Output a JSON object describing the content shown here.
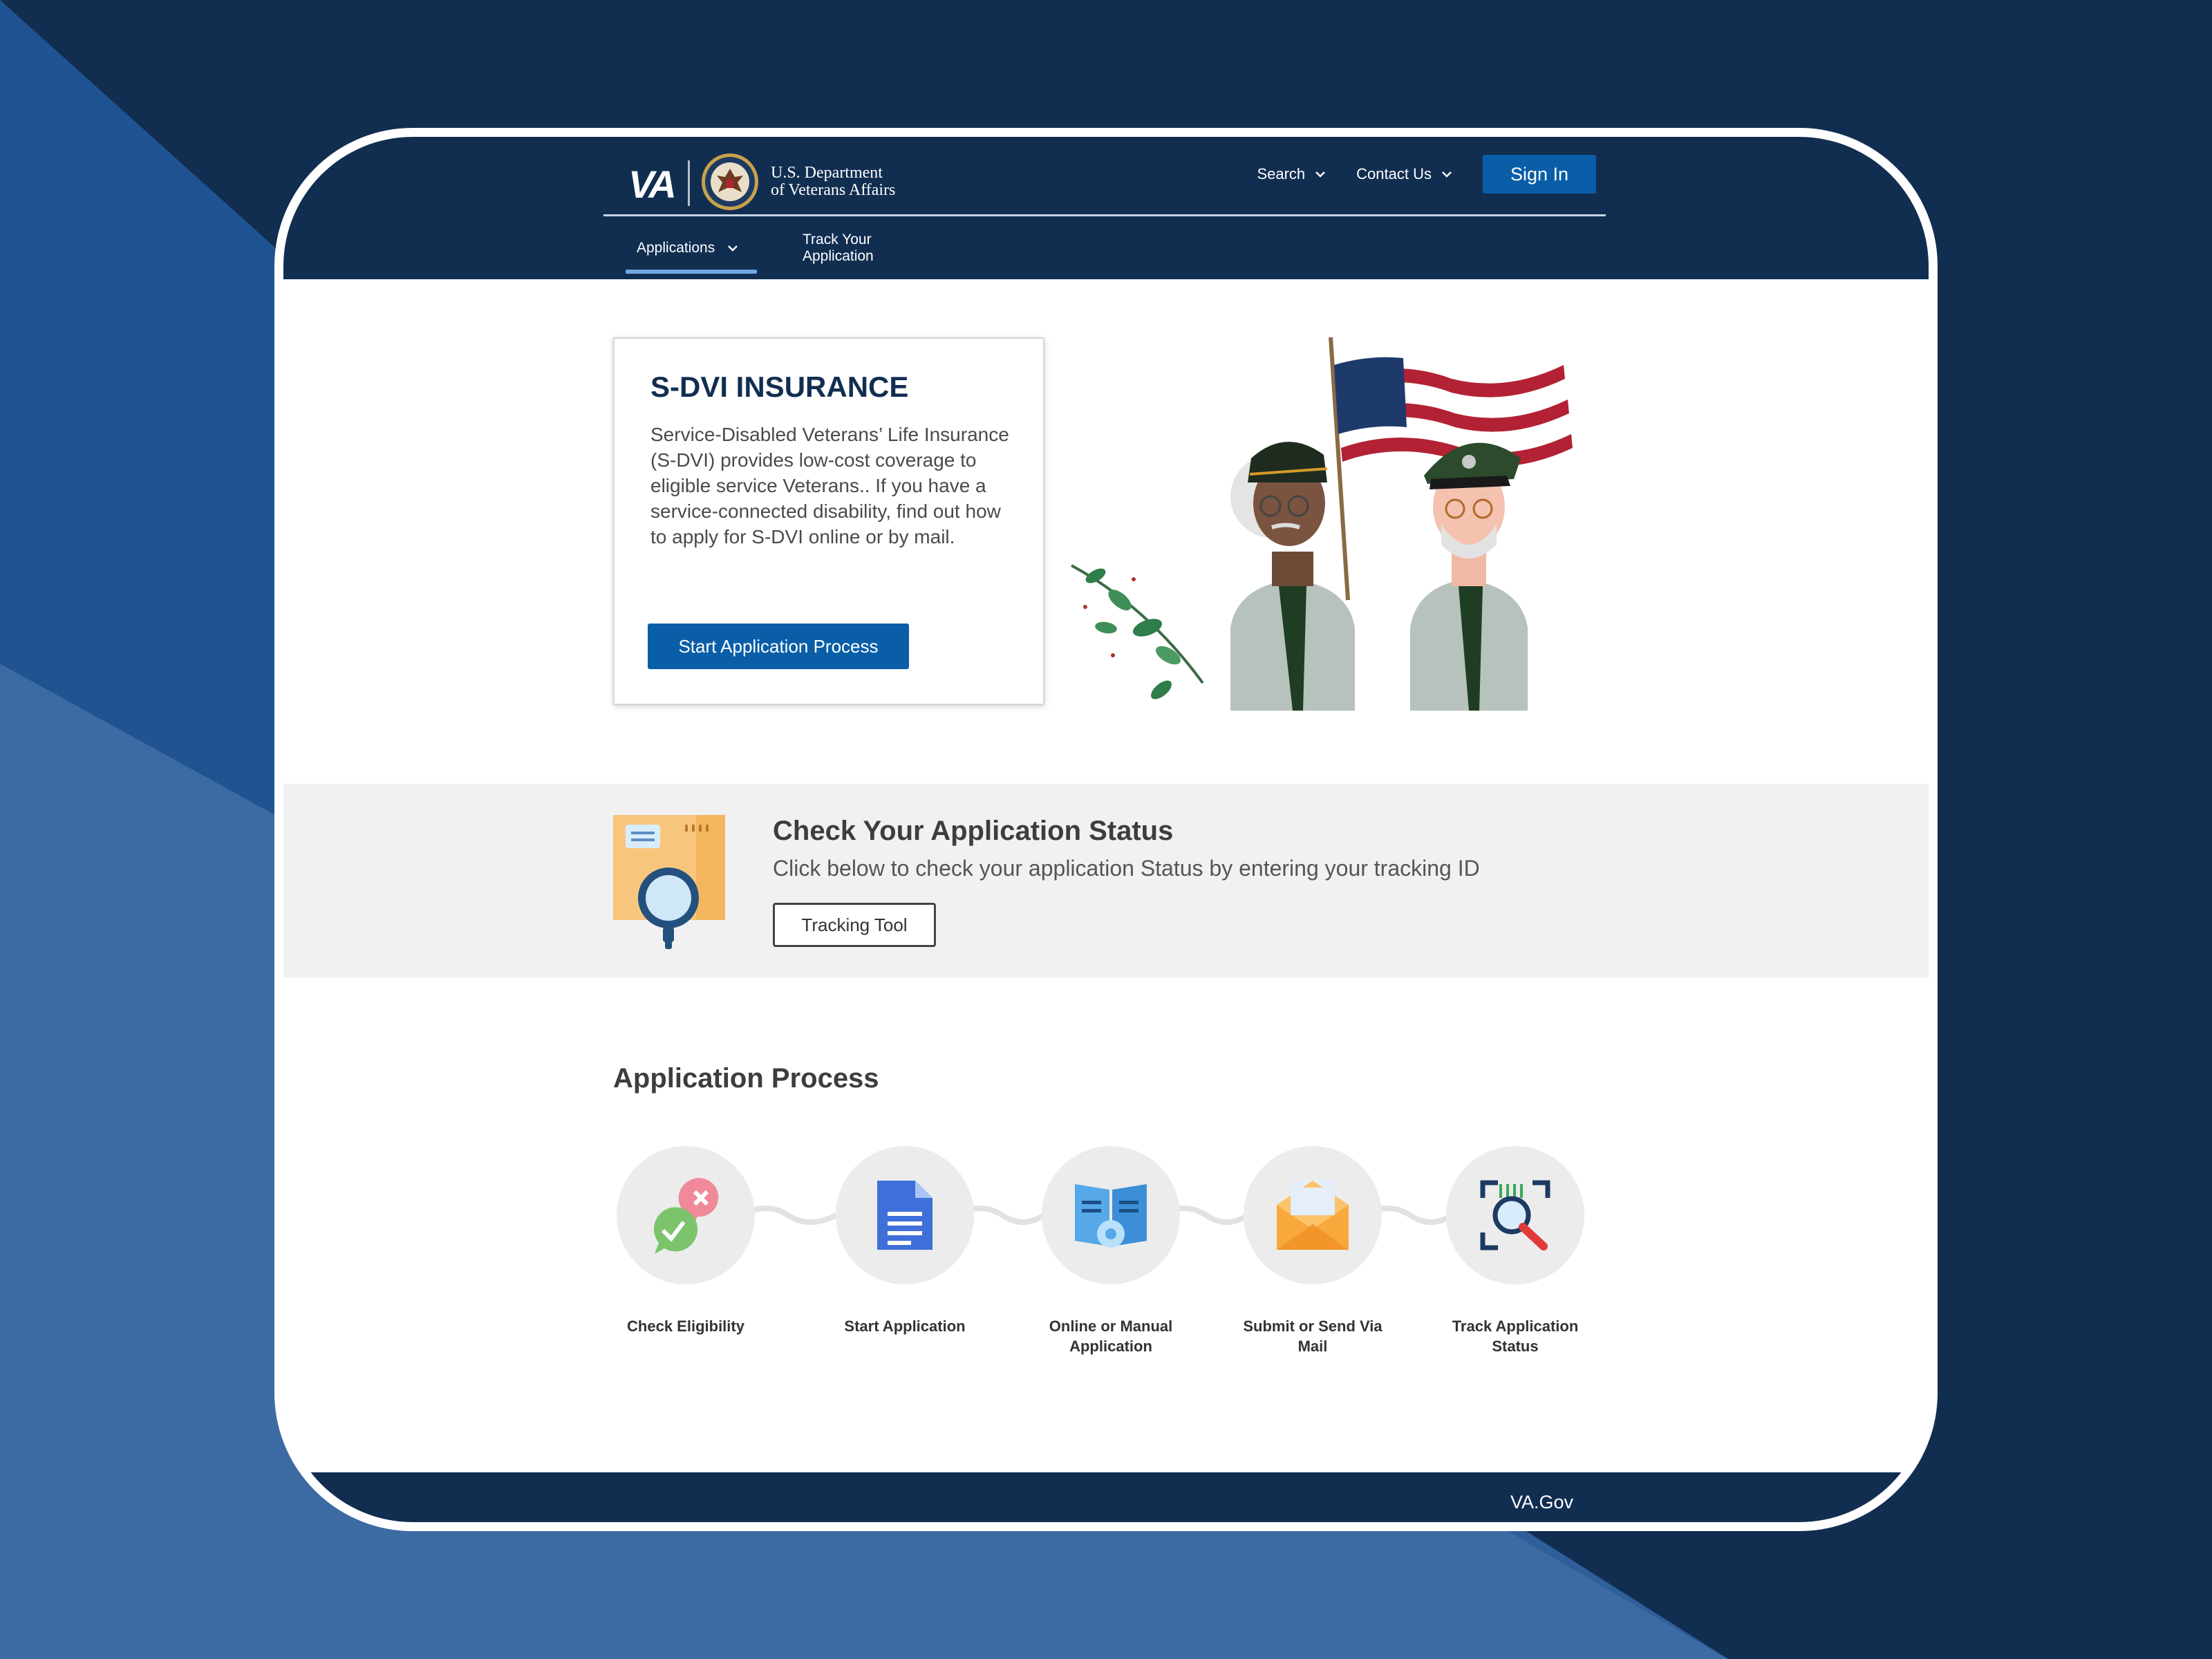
{
  "header": {
    "logo_text": "VA",
    "dept_line1": "U.S. Department",
    "dept_line2": "of Veterans Affairs",
    "search_label": "Search",
    "contact_label": "Contact Us",
    "signin_label": "Sign In",
    "icons": [
      "va-seal-icon",
      "chevron-down-icon"
    ]
  },
  "subnav": {
    "items": [
      {
        "label": "Applications",
        "active": true
      },
      {
        "label": "Track Your Application",
        "active": false
      }
    ]
  },
  "hero": {
    "title": "S-DVI INSURANCE",
    "description": "Service-Disabled Veterans’ Life Insurance (S-DVI) provides low-cost coverage to eligible service Veterans.. If you have a service-connected disability, find out how to apply for S-DVI online or by mail.",
    "button_label": "Start Application Process"
  },
  "status": {
    "title": "Check Your Application Status",
    "subtitle": "Click below to check your application Status by entering your tracking ID",
    "button_label": "Tracking Tool"
  },
  "process": {
    "title": "Application Process",
    "steps": [
      {
        "label": "Check Eligibility",
        "icon": "check-eligibility-icon"
      },
      {
        "label": "Start Application",
        "icon": "document-icon"
      },
      {
        "label": "Online or Manual Application",
        "icon": "manual-book-icon"
      },
      {
        "label": "Submit or Send Via Mail",
        "icon": "envelope-icon"
      },
      {
        "label": "Track Application Status",
        "icon": "scan-search-icon"
      }
    ]
  },
  "footer": {
    "text": "VA.Gov"
  },
  "colors": {
    "navy": "#112e51",
    "primary_button": "#0a5ea8",
    "active_underline": "#6fa7e2",
    "status_band": "#f1f1f1",
    "background_light": "#3c6aa3"
  }
}
